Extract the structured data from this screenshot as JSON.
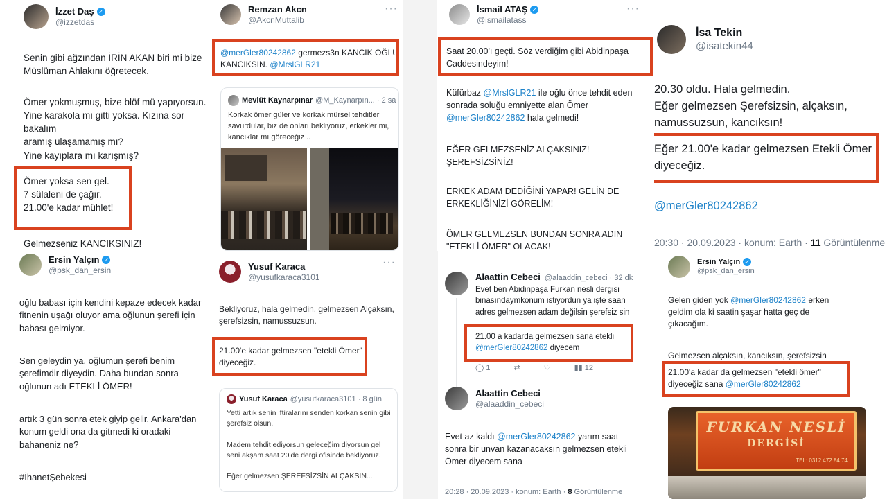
{
  "brand_red": "#d9421f",
  "mention_color": "#1d82c9",
  "p1": {
    "name": "İzzet Daş",
    "handle": "@izzetdas",
    "text1": "Senin gibi ağzından İRİN AKAN biri mi bize\nMüslüman Ahlakını öğretecek.",
    "text2": "Ömer yokmuşmuş, bize blöf mü yapıyorsun.\nYine karakola mı gitti yoksa. Kızına sor bakalım\naramış ulaşamamış mı?\nYine kayıplara mı karışmış?",
    "boxed": "Ömer yoksa sen gel.\n7 sülaleni de çağır.\n21.00'e kadar mühlet!",
    "text3": "Gelmezseniz KANCIKSINIZ!"
  },
  "p2": {
    "name": "Remzan Akcn",
    "handle": "@AkcnMuttalib",
    "boxed_mention1": "@merGler80242862",
    "boxed_rest": " germezs3n KANCIK OĞLU\nKANCIKSIN. ",
    "boxed_mention2": "@MrslGLR21",
    "q_name": "Mevlüt Kaynarpınar",
    "q_handle": "@M_Kaynarpın... · 2 sa",
    "q_text": "Korkak ömer güler ve korkak mürsel tehditler\nsavurdular, biz de onları bekliyoruz, erkekler mi,\nkancıklar mı göreceğiz .."
  },
  "p3": {
    "name": "İsmail ATAŞ",
    "handle": "@ismailatass",
    "boxed": "Saat 20.00'ı geçti. Söz verdiğim gibi Abidinpaşa\nCaddesindeyim!",
    "t1_a": "Küfürbaz ",
    "t1_m1": "@MrslGLR21",
    "t1_b": " ile oğlu önce tehdit eden\nsonrada soluğu emniyette alan Ömer\n",
    "t1_m2": "@merGler80242862",
    "t1_c": " hala gelmedi!",
    "t2": "EĞER GELMEZSENİZ ALÇAKSINIZ!\nŞEREFSİZSİNİZ!",
    "t3": "ERKEK ADAM DEDİĞİNİ YAPAR! GELİN DE\nERKEKLİĞİNİZİ GÖRELİM!",
    "t4": "ÖMER GELMEZSEN BUNDAN SONRA ADIN\n\"ETEKLİ ÖMER\" OLACAK!"
  },
  "p4": {
    "name": "İsa Tekin",
    "handle": "@isatekin44",
    "t1": "20.30 oldu. Hala gelmedin.\nEğer gelmezsen Şerefsizsin, alçaksın,\nnamussuzsun, kancıksın!",
    "boxed": "Eğer 21.00'e kadar gelmezsen Etekli Ömer\ndiyeceğiz.",
    "mention": "@merGler80242862",
    "meta_a": "20:30 · 20.09.2023 · konum: Earth · ",
    "meta_b": "11",
    "meta_c": " Görüntülenme"
  },
  "p5": {
    "name": "Ersin Yalçın",
    "handle": "@psk_dan_ersin",
    "t1": "oğlu babası için kendini kepaze edecek kadar\nfitnenin uşağı oluyor ama oğlunun şerefi için\nbabası gelmiyor.",
    "t2": "Sen geleydin ya, oğlumun şerefi benim\nşerefimdir diyeydin. Daha bundan sonra\noğlunun adı ETEKLİ ÖMER!",
    "t3": "artık 3 gün sonra etek giyip gelir. Ankara'dan\nkonum geldi ona da gitmedi ki oradaki\nbahaneniz ne?",
    "t4": "#İhanetŞebekesi"
  },
  "p6": {
    "name": "Yusuf Karaca",
    "handle": "@yusufkaraca3101",
    "t1": "Bekliyoruz, hala gelmedin, gelmezsen Alçaksın,\nşerefsizsin, namussuzsun.",
    "boxed": "21.00'e kadar gelmezsen \"etekli Ömer\"\ndiyeceğiz.",
    "q_name": "Yusuf Karaca",
    "q_handle": "@yusufkaraca3101 · 8 gün",
    "q_text": "Yetti artık senin iftiralarını senden korkan senin gibi\nşerefsiz olsun.\n\nMadem tehdit ediyorsun geleceğim diyorsun gel\nseni akşam saat 20'de dergi ofisinde bekliyoruz.\n\nEğer gelmezsen ŞEREFSİZSİN ALÇAKSIN..."
  },
  "p7": {
    "name1": "Alaattin Cebeci",
    "handle1": "@alaaddin_cebeci · 32 dk",
    "t1": "Evet ben Abidinpaşa Furkan nesli dergisi\nbinasındaymkonum istiyordun ya işte saan\nadres gelmezsen adam değilsin şerefsiz sin",
    "boxed_a": "21.00 a kadarda gelmezsen sana etekli\n",
    "boxed_m": "@merGler80242862",
    "boxed_b": " diyecem",
    "stat1": "1",
    "stat2": "",
    "stat3": "12",
    "name2": "Alaattin Cebeci",
    "handle2": "@alaaddin_cebeci",
    "t2_a": "Evet az kaldı ",
    "t2_m": "@merGler80242862",
    "t2_b": " yarım saat\nsonra bir unvan kazanacaksın gelmezsen etekli\nÖmer diyecem sana",
    "meta_a": "20:28 · 20.09.2023 · konum: Earth · ",
    "meta_b": "8",
    "meta_c": " Görüntülenme"
  },
  "p8": {
    "name": "Ersin Yalçın",
    "handle": "@psk_dan_ersin",
    "t1_a": "Gelen giden yok ",
    "t1_m": "@merGler80242862",
    "t1_b": " erken\ngeldim ola ki saatin şaşar hatta geç de\nçıkacağım.",
    "t2": "Gelmezsen alçaksın, kancıksın, şerefsizsin",
    "boxed_a": "21.00'a kadar da gelmezsen \"etekli ömer\"\ndiyeceğiz sana ",
    "boxed_m": "@merGler80242862",
    "sign1": "FURKAN NESLİ",
    "sign2": "DERGİSİ",
    "sign3": "TEL: 0312 472 84 74"
  }
}
